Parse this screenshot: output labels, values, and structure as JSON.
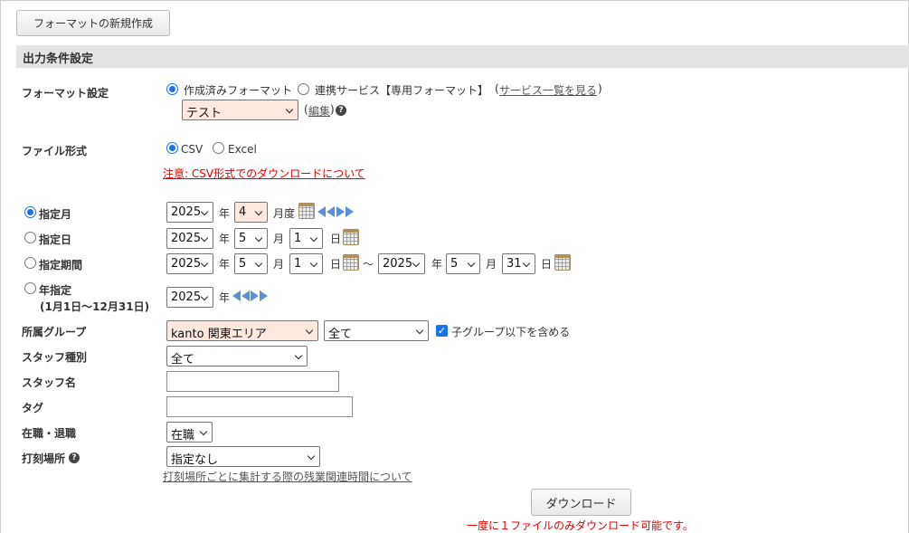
{
  "toolbar": {
    "new_format_button": "フォーマットの新規作成"
  },
  "section": {
    "title": "出力条件設定"
  },
  "format": {
    "label": "フォーマット設定",
    "option_created": "作成済みフォーマット",
    "option_service": "連携サービス【専用フォーマット】",
    "paren_open": "(",
    "paren_close": ")",
    "service_link": "サービス一覧を見る",
    "selected": "テスト",
    "edit_link": "編集",
    "help_icon": "?"
  },
  "file_format": {
    "label": "ファイル形式",
    "option_csv": "CSV",
    "option_excel": "Excel",
    "notice_link": "注意: CSV形式でのダウンロードについて"
  },
  "period": {
    "month": {
      "label": "指定月",
      "year": "2025",
      "year_unit": "年",
      "month": "4",
      "month_unit": "月度"
    },
    "day": {
      "label": "指定日",
      "year": "2025",
      "year_unit": "年",
      "month": "5",
      "month_unit": "月",
      "day": "1",
      "day_unit": "日"
    },
    "range": {
      "label": "指定期間",
      "from_year": "2025",
      "from_month": "5",
      "from_day": "1",
      "tilde": "〜",
      "to_year": "2025",
      "to_month": "5",
      "to_day": "31",
      "year_unit": "年",
      "month_unit": "月",
      "day_unit": "日"
    },
    "year": {
      "label": "年指定",
      "sublabel": "(1月1日〜12月31日)",
      "year": "2025",
      "year_unit": "年"
    }
  },
  "group": {
    "label": "所属グループ",
    "selected": "kanto 関東エリア",
    "sub_selected": "全て",
    "include_children": "子グループ以下を含める"
  },
  "staff_type": {
    "label": "スタッフ種別",
    "selected": "全て"
  },
  "staff_name": {
    "label": "スタッフ名",
    "value": ""
  },
  "tag": {
    "label": "タグ",
    "value": ""
  },
  "employment": {
    "label": "在職・退職",
    "selected": "在職"
  },
  "punch_place": {
    "label": "打刻場所",
    "selected": "指定なし",
    "overtime_link": "打刻場所ごとに集計する際の残業関連時間について"
  },
  "download": {
    "button": "ダウンロード",
    "notice": "一度に１ファイルのみダウンロード可能です。"
  },
  "colors": {
    "accent": "#1a73e8",
    "warning": "#e00000",
    "section_bg": "#e4e4e4",
    "select_highlight": "#fde8df"
  }
}
